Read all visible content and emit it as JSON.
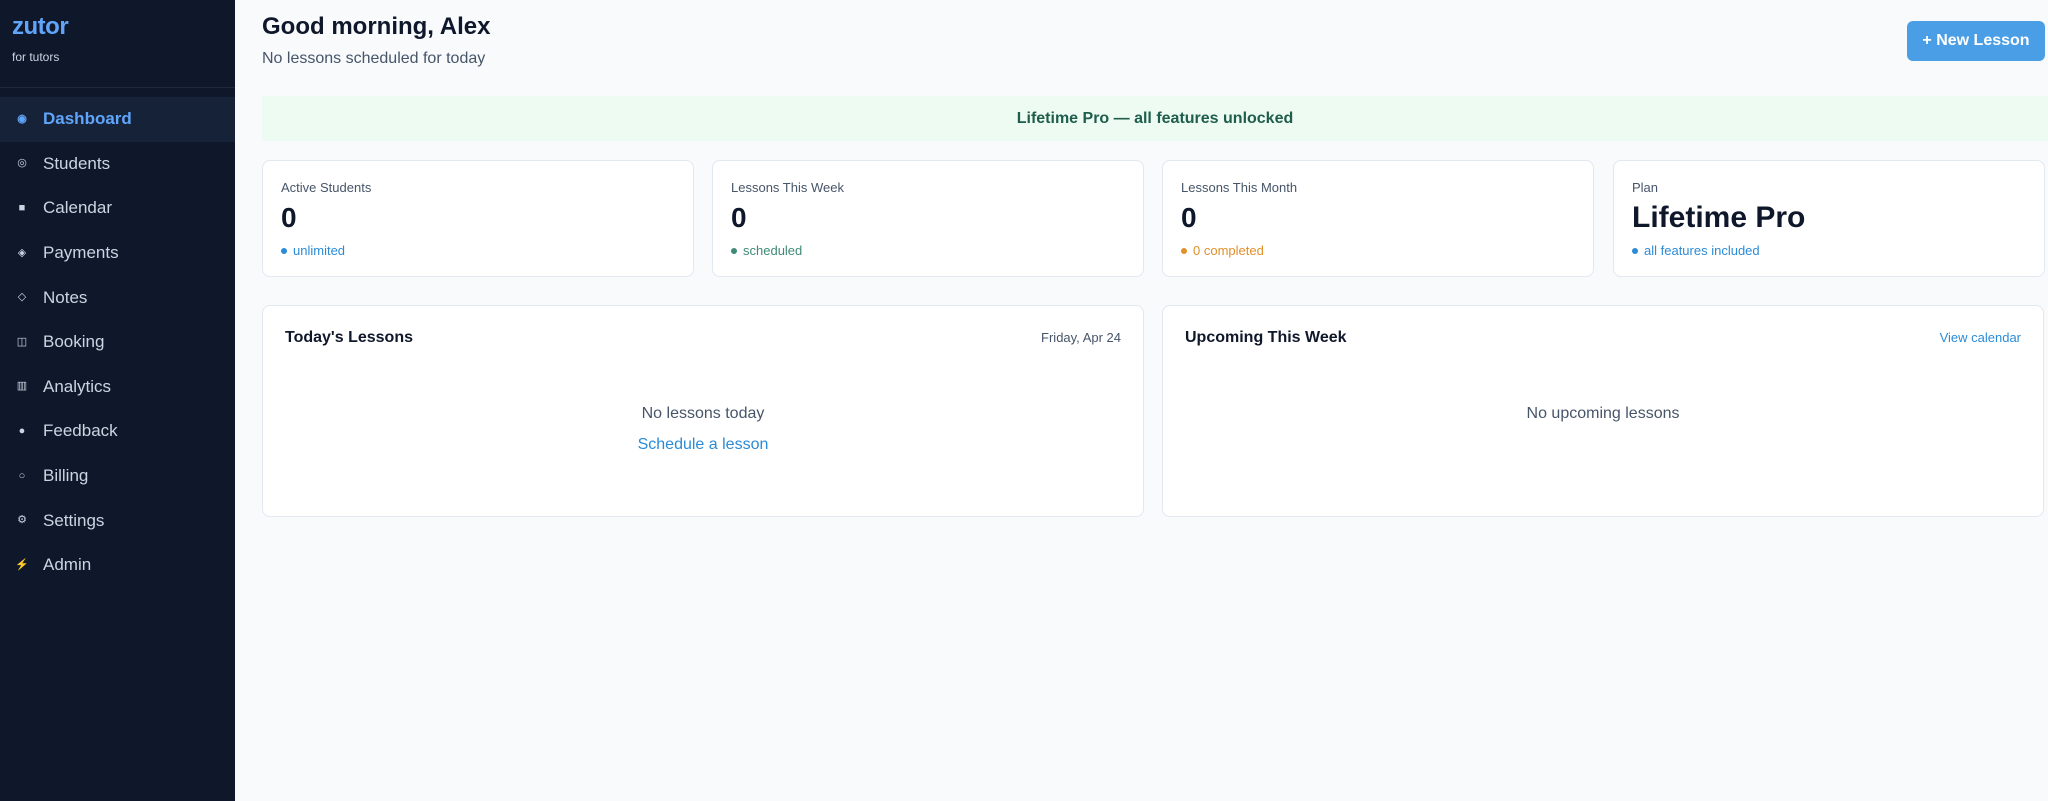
{
  "brand": {
    "name": "zutor",
    "tagline": "for tutors"
  },
  "sidebar": {
    "items": [
      {
        "label": "Dashboard",
        "icon": "dashboard-icon",
        "glyph": "◉",
        "active": true
      },
      {
        "label": "Students",
        "icon": "students-icon",
        "glyph": "◎",
        "active": false
      },
      {
        "label": "Calendar",
        "icon": "calendar-icon",
        "glyph": "■",
        "active": false
      },
      {
        "label": "Payments",
        "icon": "payments-icon",
        "glyph": "◈",
        "active": false
      },
      {
        "label": "Notes",
        "icon": "notes-icon",
        "glyph": "◇",
        "active": false
      },
      {
        "label": "Booking",
        "icon": "booking-icon",
        "glyph": "◫",
        "active": false
      },
      {
        "label": "Analytics",
        "icon": "analytics-icon",
        "glyph": "▥",
        "active": false
      },
      {
        "label": "Feedback",
        "icon": "feedback-icon",
        "glyph": "●",
        "active": false
      },
      {
        "label": "Billing",
        "icon": "billing-icon",
        "glyph": "○",
        "active": false
      },
      {
        "label": "Settings",
        "icon": "settings-icon",
        "glyph": "⚙",
        "active": false
      },
      {
        "label": "Admin",
        "icon": "admin-icon",
        "glyph": "⚡",
        "active": false
      }
    ]
  },
  "header": {
    "greeting": "Good morning, Alex",
    "subtitle": "No lessons scheduled for today",
    "new_lesson_label": "+ New Lesson"
  },
  "banner": {
    "text": "Lifetime Pro — all features unlocked"
  },
  "stats": [
    {
      "label": "Active Students",
      "value": "0",
      "note": "unlimited",
      "tone": "blue"
    },
    {
      "label": "Lessons This Week",
      "value": "0",
      "note": "scheduled",
      "tone": "green"
    },
    {
      "label": "Lessons This Month",
      "value": "0",
      "note": "0 completed",
      "tone": "orange"
    },
    {
      "label": "Plan",
      "value": "Lifetime Pro",
      "note": "all features included",
      "tone": "blue"
    }
  ],
  "today": {
    "title": "Today's Lessons",
    "date": "Friday, Apr 24",
    "empty_text": "No lessons today",
    "action_label": "Schedule a lesson"
  },
  "upcoming": {
    "title": "Upcoming This Week",
    "link_label": "View calendar",
    "empty_text": "No upcoming lessons"
  },
  "colors": {
    "sidebar_bg": "#0f172a",
    "accent": "#4a9ee6",
    "link": "#2b8bd6",
    "banner_bg": "#eefbf3",
    "banner_text": "#1f5d4d",
    "green_note": "#3f8a76",
    "orange_note": "#e1902a"
  }
}
